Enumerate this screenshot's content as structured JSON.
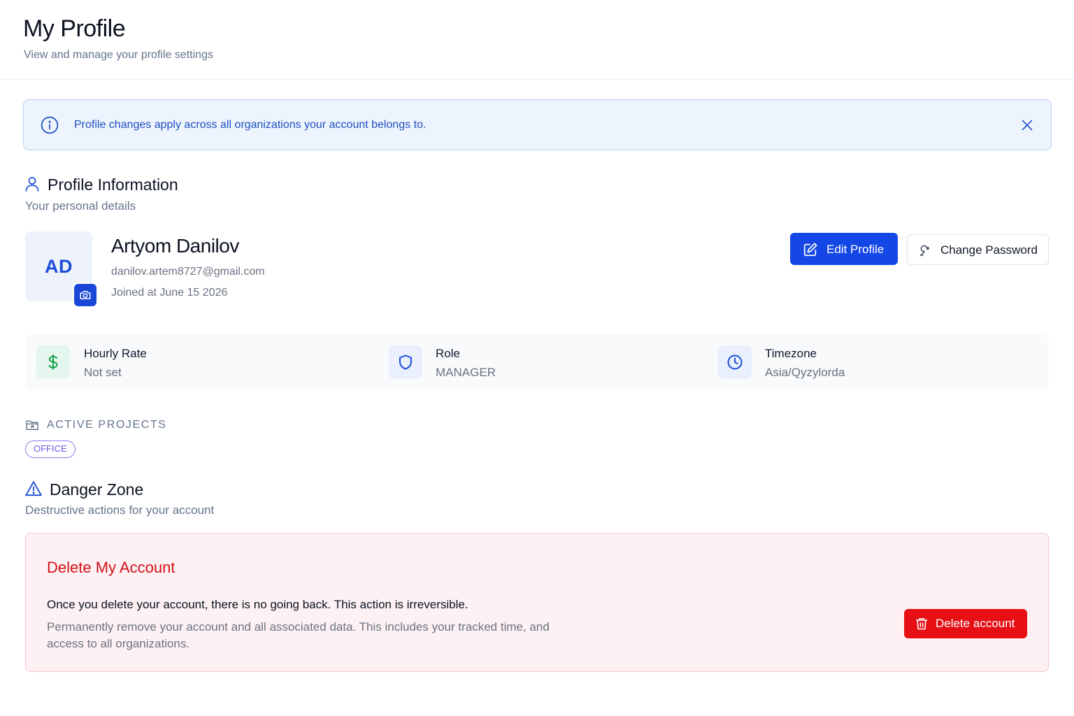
{
  "header": {
    "title": "My Profile",
    "subtitle": "View and manage your profile settings"
  },
  "banner": {
    "text": "Profile changes apply across all organizations your account belongs to.",
    "icon": "info-icon",
    "close_icon": "close-icon"
  },
  "profile_section": {
    "title": "Profile Information",
    "subtitle": "Your personal details",
    "icon": "user-icon"
  },
  "user": {
    "initials": "AD",
    "name": "Artyom Danilov",
    "email": "danilov.artem8727@gmail.com",
    "joined": "Joined at June 15 2026"
  },
  "actions": {
    "edit_label": "Edit Profile",
    "change_password_label": "Change Password"
  },
  "stats": [
    {
      "label": "Hourly Rate",
      "value": "Not set",
      "icon": "dollar-icon"
    },
    {
      "label": "Role",
      "value": "MANAGER",
      "icon": "shield-icon"
    },
    {
      "label": "Timezone",
      "value": "Asia/Qyzylorda",
      "icon": "clock-icon"
    }
  ],
  "projects": {
    "heading": "ACTIVE PROJECTS",
    "items": [
      "OFFICE"
    ]
  },
  "danger_section": {
    "title": "Danger Zone",
    "subtitle": "Destructive actions for your account",
    "card_title": "Delete My Account",
    "warning": "Once you delete your account, there is no going back. This action is irreversible.",
    "description": "Permanently remove your account and all associated data. This includes your tracked time, and access to all organizations.",
    "button_label": "Delete account"
  },
  "colors": {
    "primary": "#1447e6",
    "danger": "#e50f14",
    "banner_bg": "#eef4fd",
    "badge": "#8b7cf0"
  }
}
